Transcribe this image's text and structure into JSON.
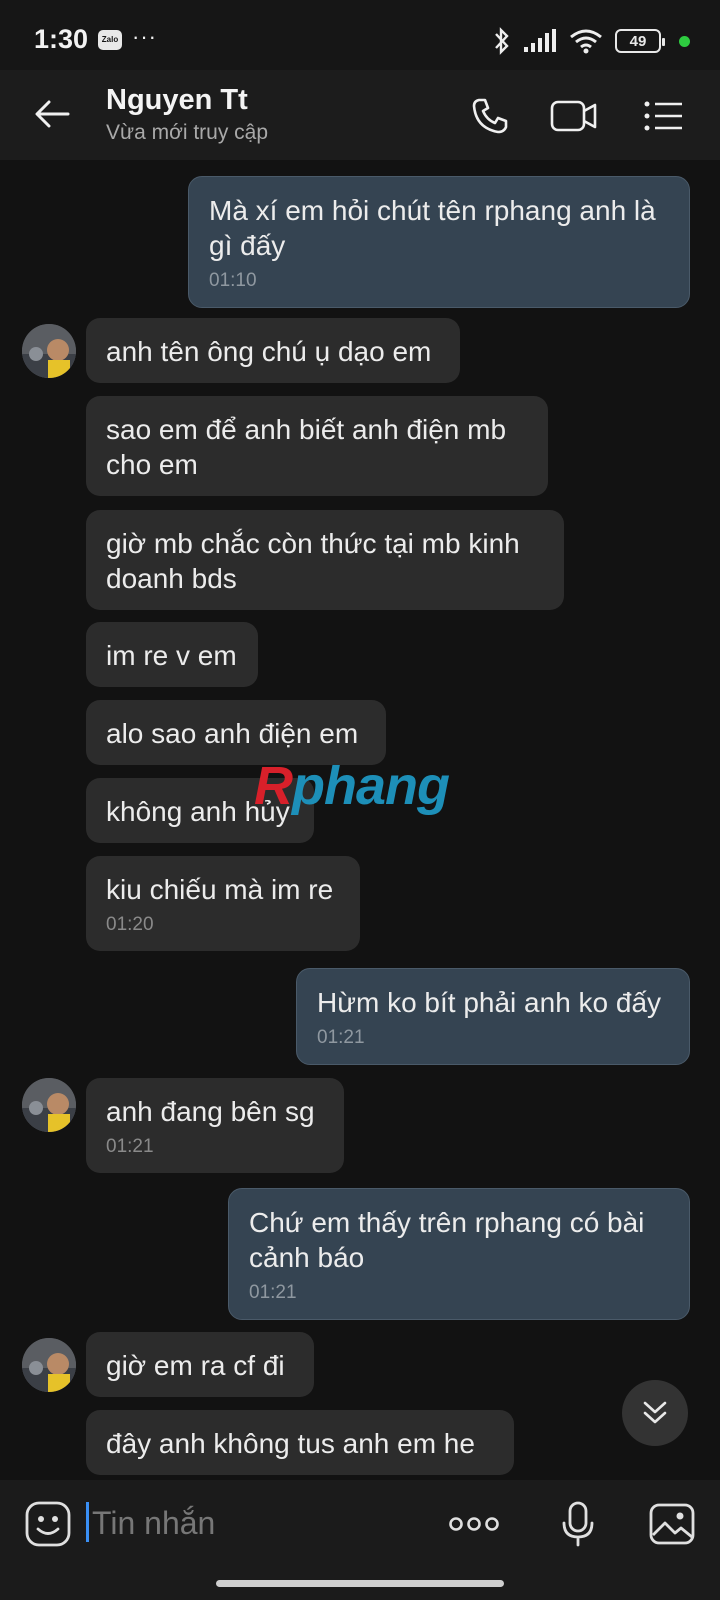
{
  "status_bar": {
    "time": "1:30",
    "app_badge": "Zalo",
    "dots": "···",
    "battery": "49"
  },
  "header": {
    "contact_name": "Nguyen Tt",
    "contact_status": "Vừa mới truy cập"
  },
  "messages": [
    {
      "dir": "out",
      "text": "Mà xí em hỏi chút tên rphang anh là gì đấy",
      "time": "01:10"
    },
    {
      "dir": "in",
      "text": "anh tên ông chú ụ dạo em",
      "time": ""
    },
    {
      "dir": "in",
      "text": "sao em để anh biết anh điện mb cho em",
      "time": ""
    },
    {
      "dir": "in",
      "text": "giờ mb chắc còn thức tại mb kinh doanh bds",
      "time": ""
    },
    {
      "dir": "in",
      "text": "im re v em",
      "time": ""
    },
    {
      "dir": "in",
      "text": "alo sao anh điện em",
      "time": ""
    },
    {
      "dir": "in",
      "text": "không anh hủy",
      "time": ""
    },
    {
      "dir": "in",
      "text": "kiu chiếu mà im re",
      "time": "01:20"
    },
    {
      "dir": "out",
      "text": "Hừm ko bít phải anh ko đấy",
      "time": "01:21"
    },
    {
      "dir": "in",
      "text": "anh đang bên sg",
      "time": "01:21"
    },
    {
      "dir": "out",
      "text": "Chứ em thấy trên rphang có bài cảnh báo",
      "time": "01:21"
    },
    {
      "dir": "in",
      "text": "giờ em ra cf đi",
      "time": ""
    },
    {
      "dir": "in",
      "text": "đây anh không tus anh em he",
      "time": ""
    }
  ],
  "watermark": {
    "first": "R",
    "rest": "phang"
  },
  "input": {
    "placeholder": "Tin nhắn"
  },
  "colors": {
    "outgoing_bubble": "#354452",
    "incoming_bubble": "#2c2c2c",
    "background": "#121212",
    "caret": "#3a8ff5"
  }
}
